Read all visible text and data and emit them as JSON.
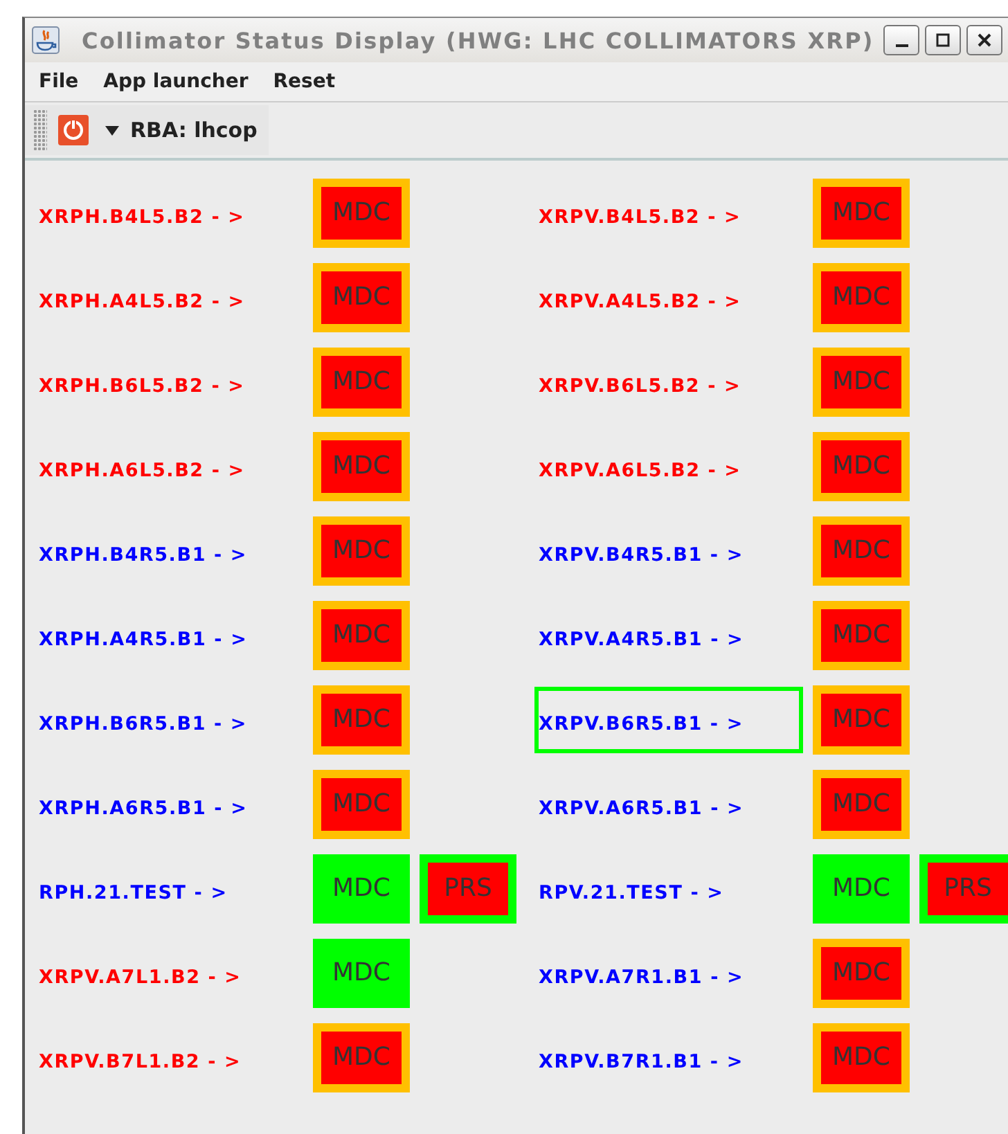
{
  "window": {
    "title": "Collimator Status Display (HWG: LHC COLLIMATORS XRP)"
  },
  "menu": [
    "File",
    "App launcher",
    "Reset"
  ],
  "toolbar": {
    "role": "RBA: lhcop"
  },
  "rows": [
    [
      {
        "name": "XRPH.B4L5.B2 - >",
        "color": "#ff0000",
        "selected": false,
        "statuses": [
          {
            "label": "MDC",
            "kind": "alarm"
          }
        ]
      },
      {
        "name": "XRPV.B4L5.B2 - >",
        "color": "#ff0000",
        "selected": false,
        "statuses": [
          {
            "label": "MDC",
            "kind": "alarm"
          }
        ]
      }
    ],
    [
      {
        "name": "XRPH.A4L5.B2 - >",
        "color": "#ff0000",
        "selected": false,
        "statuses": [
          {
            "label": "MDC",
            "kind": "alarm"
          }
        ]
      },
      {
        "name": "XRPV.A4L5.B2 - >",
        "color": "#ff0000",
        "selected": false,
        "statuses": [
          {
            "label": "MDC",
            "kind": "alarm"
          }
        ]
      }
    ],
    [
      {
        "name": "XRPH.B6L5.B2 - >",
        "color": "#ff0000",
        "selected": false,
        "statuses": [
          {
            "label": "MDC",
            "kind": "alarm"
          }
        ]
      },
      {
        "name": "XRPV.B6L5.B2 - >",
        "color": "#ff0000",
        "selected": false,
        "statuses": [
          {
            "label": "MDC",
            "kind": "alarm"
          }
        ]
      }
    ],
    [
      {
        "name": "XRPH.A6L5.B2 - >",
        "color": "#ff0000",
        "selected": false,
        "statuses": [
          {
            "label": "MDC",
            "kind": "alarm"
          }
        ]
      },
      {
        "name": "XRPV.A6L5.B2 - >",
        "color": "#ff0000",
        "selected": false,
        "statuses": [
          {
            "label": "MDC",
            "kind": "alarm"
          }
        ]
      }
    ],
    [
      {
        "name": "XRPH.B4R5.B1 - >",
        "color": "#0000ff",
        "selected": false,
        "statuses": [
          {
            "label": "MDC",
            "kind": "alarm"
          }
        ]
      },
      {
        "name": "XRPV.B4R5.B1 - >",
        "color": "#0000ff",
        "selected": false,
        "statuses": [
          {
            "label": "MDC",
            "kind": "alarm"
          }
        ]
      }
    ],
    [
      {
        "name": "XRPH.A4R5.B1 - >",
        "color": "#0000ff",
        "selected": false,
        "statuses": [
          {
            "label": "MDC",
            "kind": "alarm"
          }
        ]
      },
      {
        "name": "XRPV.A4R5.B1 - >",
        "color": "#0000ff",
        "selected": false,
        "statuses": [
          {
            "label": "MDC",
            "kind": "alarm"
          }
        ]
      }
    ],
    [
      {
        "name": "XRPH.B6R5.B1 - >",
        "color": "#0000ff",
        "selected": false,
        "statuses": [
          {
            "label": "MDC",
            "kind": "alarm"
          }
        ]
      },
      {
        "name": "XRPV.B6R5.B1 - >",
        "color": "#0000ff",
        "selected": true,
        "statuses": [
          {
            "label": "MDC",
            "kind": "alarm"
          }
        ]
      }
    ],
    [
      {
        "name": "XRPH.A6R5.B1 - >",
        "color": "#0000ff",
        "selected": false,
        "statuses": [
          {
            "label": "MDC",
            "kind": "alarm"
          }
        ]
      },
      {
        "name": "XRPV.A6R5.B1 - >",
        "color": "#0000ff",
        "selected": false,
        "statuses": [
          {
            "label": "MDC",
            "kind": "alarm"
          }
        ]
      }
    ],
    [
      {
        "name": "RPH.21.TEST - >",
        "color": "#0000ff",
        "selected": false,
        "statuses": [
          {
            "label": "MDC",
            "kind": "ok"
          },
          {
            "label": "PRS",
            "kind": "error"
          }
        ]
      },
      {
        "name": "RPV.21.TEST - >",
        "color": "#0000ff",
        "selected": false,
        "statuses": [
          {
            "label": "MDC",
            "kind": "ok"
          },
          {
            "label": "PRS",
            "kind": "error"
          }
        ]
      }
    ],
    [
      {
        "name": "XRPV.A7L1.B2 - >",
        "color": "#ff0000",
        "selected": false,
        "statuses": [
          {
            "label": "MDC",
            "kind": "ok"
          }
        ]
      },
      {
        "name": "XRPV.A7R1.B1 - >",
        "color": "#0000ff",
        "selected": false,
        "statuses": [
          {
            "label": "MDC",
            "kind": "alarm"
          }
        ]
      }
    ],
    [
      {
        "name": "XRPV.B7L1.B2 - >",
        "color": "#ff0000",
        "selected": false,
        "statuses": [
          {
            "label": "MDC",
            "kind": "alarm"
          }
        ]
      },
      {
        "name": "XRPV.B7R1.B1 - >",
        "color": "#0000ff",
        "selected": false,
        "statuses": [
          {
            "label": "MDC",
            "kind": "alarm"
          }
        ]
      }
    ]
  ]
}
